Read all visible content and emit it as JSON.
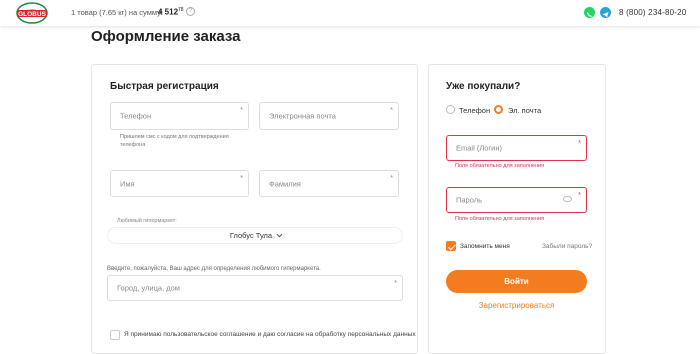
{
  "header": {
    "logo_text": "GLOBUS",
    "cart_text": "1 товар (7.65 кг) на сумму:",
    "cart_sum": "4 512",
    "cart_currency": "78",
    "phone": "8 (800) 234-80-20"
  },
  "page_title": "Оформление заказа",
  "quick_reg": {
    "title": "Быстрая регистрация",
    "phone_placeholder": "Телефон",
    "email_placeholder": "Электронная почта",
    "sms_hint_1": "Пришлем смс с кодом для подтверждения",
    "sms_hint_2": "телефона",
    "name_placeholder": "Имя",
    "surname_placeholder": "Фамилия",
    "store_label": "Любимый гипермаркет:",
    "store_value": "Глобус Тула",
    "address_prompt": "Введите, пожалуйста, Ваш адрес для определения любимого гипермаркета.",
    "address_placeholder": "Город, улица, дом",
    "agree_text_1": "Я принимаю",
    "agree_link_1": "пользовательское соглашение",
    "agree_text_2": "и даю согласие",
    "agree_link_2": "на обработку персональных данных",
    "required_mark": "*"
  },
  "login": {
    "title": "Уже покупали?",
    "radio_phone": "Телефон",
    "radio_email": "Эл. почта",
    "email_placeholder": "Email (Логин)",
    "password_placeholder": "Пароль",
    "error_required": "Поле обязательно для заполнения",
    "remember_label": "Запомнить меня",
    "forgot_link": "Забыли пароль?",
    "login_button": "Войти",
    "register_link": "Зарегистрироваться",
    "required_mark": "*"
  },
  "colors": {
    "accent": "#f47c20",
    "error": "#e0314f",
    "logo_green": "#1f8a3c",
    "logo_red": "#d9262b"
  },
  "icons": {
    "whatsapp": "whatsapp-icon",
    "telegram": "telegram-icon",
    "info": "info-icon",
    "eye": "eye-icon",
    "chevron": "chevron-down-icon"
  }
}
